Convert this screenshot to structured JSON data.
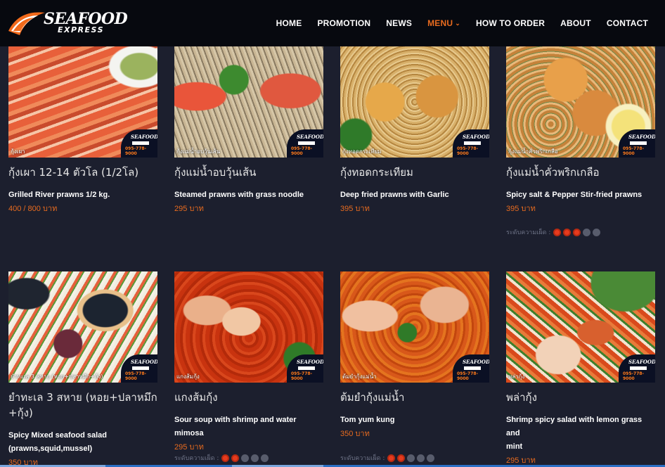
{
  "brand": {
    "line1": "SEAFOOD",
    "line2": "EXPRESS"
  },
  "nav": {
    "items": [
      {
        "label": "HOME"
      },
      {
        "label": "PROMOTION"
      },
      {
        "label": "NEWS"
      },
      {
        "label": "MENU",
        "active": true
      },
      {
        "label": "HOW TO ORDER"
      },
      {
        "label": "ABOUT"
      },
      {
        "label": "CONTACT"
      }
    ]
  },
  "badge": {
    "brand": "SEAFOOD",
    "phone": "095-778-9000"
  },
  "spicy_label": "ระดับความเผ็ด :",
  "colors": {
    "accent": "#e86b1f",
    "background": "#1c1f2e",
    "navbar": "#07090f",
    "chili": "#e63b1e"
  },
  "menu": [
    {
      "thai": "กุ้งเผา 12-14 ตัวโล (1/2โล)",
      "english": "Grilled River prawns 1/2 kg.",
      "price": "400 / 800 บาท",
      "caption": "กุ้งเผา",
      "spicy": null
    },
    {
      "thai": "กุ้งแม่น้ำอบวุ้นเส้น",
      "english": "Steamed prawns with grass noodle",
      "price": "295 บาท",
      "caption": "กุ้งแม่น้ำอบวุ้นเส้น",
      "spicy": null
    },
    {
      "thai": "กุ้งทอดกระเทียม",
      "english": "Deep fried prawns with Garlic",
      "price": "395 บาท",
      "caption": "กุ้งทอดกระเทียม",
      "spicy": null
    },
    {
      "thai": "กุ้งแม่น้ำคั่วพริกเกลือ",
      "english": "Spicy salt & Pepper Stir-fried prawns",
      "price": "395 บาท",
      "caption": "กุ้งแม่น้ำคั่วพริกเกลือ",
      "spicy": 3
    },
    {
      "thai": "ยำทะเล 3 สหาย (หอย+ปลาหมึก+กุ้ง)",
      "thai_line1": "ยำทะเล 3 สหาย (หอย+ปลาหมึก",
      "thai_line2": "+กุ้ง)",
      "english": "Spicy Mixed seafood salad (prawns,squid,mussel)",
      "english_line1": "Spicy Mixed seafood salad",
      "english_line2": "(prawns,squid,mussel)",
      "price": "350 บาท",
      "caption": "ยำทะเล 3 สหาย (หอย+ปลาหมึก+กุ้ง)",
      "spicy": null
    },
    {
      "thai": "แกงส้มกุ้ง",
      "english": "Sour soup with shrimp and water mimosa",
      "price": "295 บาท",
      "caption": "แกงส้มกุ้ง",
      "spicy": 2
    },
    {
      "thai": "ต้มยำกุ้งแม่น้ำ",
      "english": "Tom yum kung",
      "price": "350 บาท",
      "caption": "ต้มยำกุ้งแม่น้ำ",
      "spicy": 2
    },
    {
      "thai": "พล่ากุ้ง",
      "english": "Shrimp spicy salad with lemon grass and mint",
      "english_line1": "Shrimp spicy salad with lemon grass and",
      "english_line2": "mint",
      "price": "295 บาท",
      "caption": "พล่ากุ้ง",
      "spicy": null
    }
  ]
}
